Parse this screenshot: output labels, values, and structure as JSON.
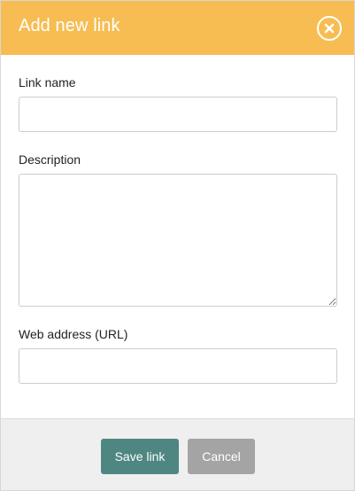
{
  "dialog": {
    "title": "Add new link",
    "close_icon": "close-circle-icon"
  },
  "form": {
    "link_name": {
      "label": "Link name",
      "value": "",
      "placeholder": ""
    },
    "description": {
      "label": "Description",
      "value": "",
      "placeholder": ""
    },
    "web_address": {
      "label": "Web address (URL)",
      "value": "",
      "placeholder": ""
    }
  },
  "footer": {
    "save_label": "Save link",
    "cancel_label": "Cancel"
  },
  "colors": {
    "header": "#f7bd52",
    "save_button": "#4e8782",
    "cancel_button": "#a4a4a4",
    "footer": "#efefef"
  }
}
